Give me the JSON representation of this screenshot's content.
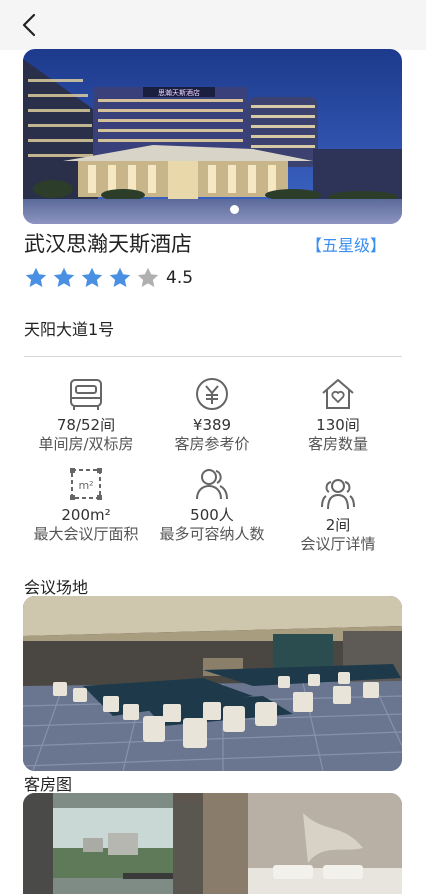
{
  "hotel": {
    "name": "武汉思瀚天斯酒店",
    "star_badge": "【五星级】",
    "rating_value": "4.5",
    "stars_filled": 4,
    "stars_total": 5,
    "address": "天阳大道1号"
  },
  "stats": [
    {
      "value": "78/52间",
      "label": "单间房/双标房",
      "icon": "bed-icon"
    },
    {
      "value": "¥389",
      "label": "客房参考价",
      "icon": "yuan-icon"
    },
    {
      "value": "130间",
      "label": "客房数量",
      "icon": "house-heart-icon"
    },
    {
      "value": "200m²",
      "label": "最大会议厅面积",
      "icon": "area-icon"
    },
    {
      "value": "500人",
      "label": "最多可容纳人数",
      "icon": "person-icon"
    },
    {
      "value": "2间",
      "label": "会议厅详情",
      "icon": "group-icon"
    }
  ],
  "sections": {
    "meeting": "会议场地",
    "rooms": "客房图"
  },
  "hero_sign": "思瀚天斯酒店",
  "colors": {
    "accent": "#3b8ef2",
    "star_filled": "#4a90e2",
    "star_empty": "#b0b0b0"
  }
}
